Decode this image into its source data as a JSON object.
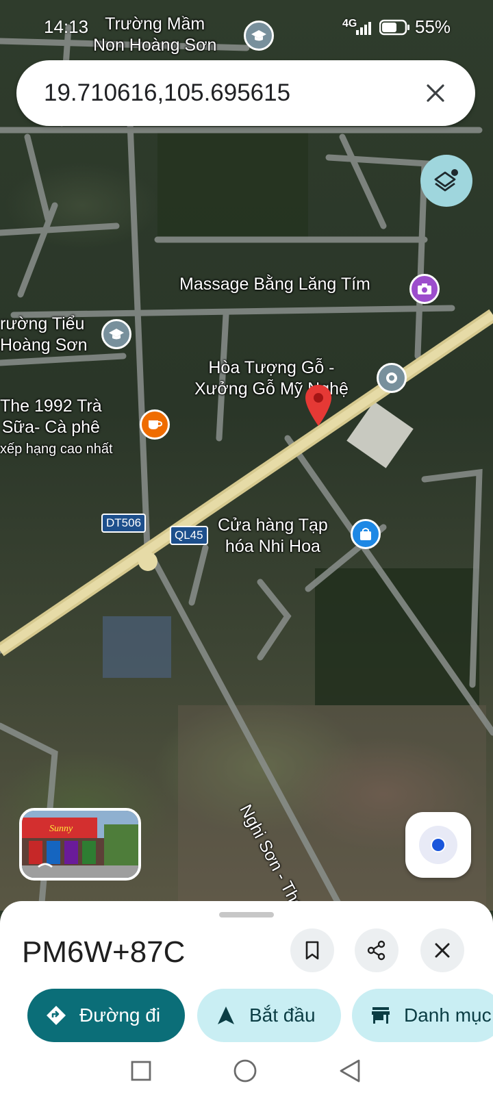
{
  "status": {
    "time": "14:13",
    "network": "4G",
    "battery": "55%"
  },
  "search": {
    "value": "19.710616,105.695615"
  },
  "map": {
    "labels": {
      "school_top": [
        "Trường Mầm",
        "Non Hoàng Sơn"
      ],
      "massage": "Massage Bằng Lăng Tím",
      "school_left": [
        "rường Tiểu",
        "Hoàng Sơn"
      ],
      "wood": [
        "Hòa Tượng Gỗ -",
        "Xưởng Gỗ Mỹ Nghệ"
      ],
      "cafe": [
        "The 1992 Trà",
        "Sữa- Cà phê"
      ],
      "cafe_sub": "xếp hạng cao nhất",
      "shop": [
        "Cửa hàng Tạp",
        "hóa Nhi Hoa"
      ],
      "road_dt": "DT506",
      "road_ql": "QL45",
      "road_name": "Nghi Sơn - Thọ Xuâ"
    }
  },
  "place": {
    "plus_code": "PM6W+87C",
    "actions": {
      "directions": "Đường đi",
      "start": "Bắt đầu",
      "category": "Danh mục"
    }
  },
  "colors": {
    "accent": "#0b6e78",
    "chip_bg": "#c9eef3",
    "pin": "#e53935"
  }
}
